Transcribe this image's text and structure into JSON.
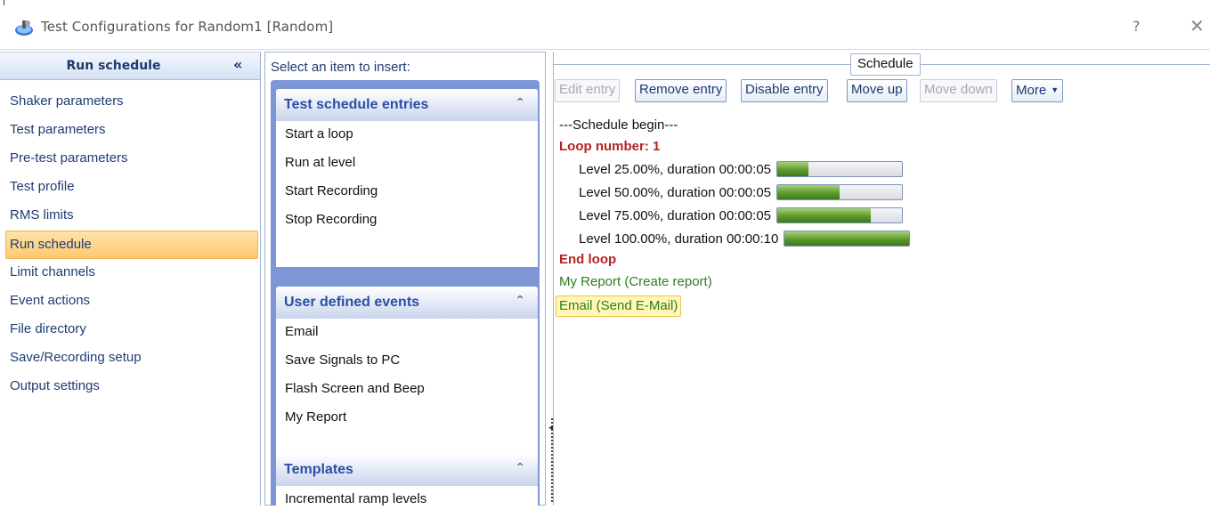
{
  "window": {
    "title": "Test Configurations for Random1 [Random]",
    "help_glyph": "?",
    "close_glyph": "✕",
    "icon": "app-icon"
  },
  "sidebar": {
    "header": "Run schedule",
    "collapse_glyph": "«",
    "items": [
      {
        "label": "Shaker parameters"
      },
      {
        "label": "Test parameters"
      },
      {
        "label": "Pre-test parameters"
      },
      {
        "label": "Test profile"
      },
      {
        "label": "RMS limits"
      },
      {
        "label": "Run schedule",
        "selected": true
      },
      {
        "label": "Limit channels"
      },
      {
        "label": "Event actions"
      },
      {
        "label": "File directory"
      },
      {
        "label": "Save/Recording setup"
      },
      {
        "label": "Output settings"
      }
    ]
  },
  "insert_panel": {
    "caption": "Select an item to insert:",
    "groups": [
      {
        "title": "Test schedule entries",
        "toggle": "⌃",
        "items": [
          "Start a loop",
          "Run at level",
          "Start Recording",
          "Stop Recording"
        ]
      },
      {
        "title": "User defined events",
        "toggle": "⌃",
        "items": [
          "Email",
          "Save Signals to PC",
          "Flash Screen and Beep",
          "My Report"
        ]
      },
      {
        "title": "Templates",
        "toggle": "⌃",
        "items": [
          "Incremental ramp levels"
        ]
      }
    ]
  },
  "schedule": {
    "legend": "Schedule",
    "toolbar": {
      "edit_entry": "Edit entry",
      "remove_entry": "Remove entry",
      "disable_entry": "Disable entry",
      "move_up": "Move up",
      "move_down": "Move down",
      "more": "More"
    },
    "begin": "---Schedule begin---",
    "loop_start": "Loop number: 1",
    "levels": [
      {
        "text": "Level 25.00%, duration 00:00:05",
        "progress": 0.25
      },
      {
        "text": "Level 50.00%, duration 00:00:05",
        "progress": 0.5
      },
      {
        "text": "Level 75.00%, duration 00:00:05",
        "progress": 0.75
      },
      {
        "text": "Level 100.00%, duration 00:00:10",
        "progress": 1.0
      }
    ],
    "loop_end": "End loop",
    "report": "My Report (Create report)",
    "email": "Email (Send E-Mail)"
  },
  "colors": {
    "accent_blue": "#1e3970",
    "selected_bg": "#fdc870",
    "loop_red": "#b32323",
    "event_green": "#2f7d1e"
  }
}
